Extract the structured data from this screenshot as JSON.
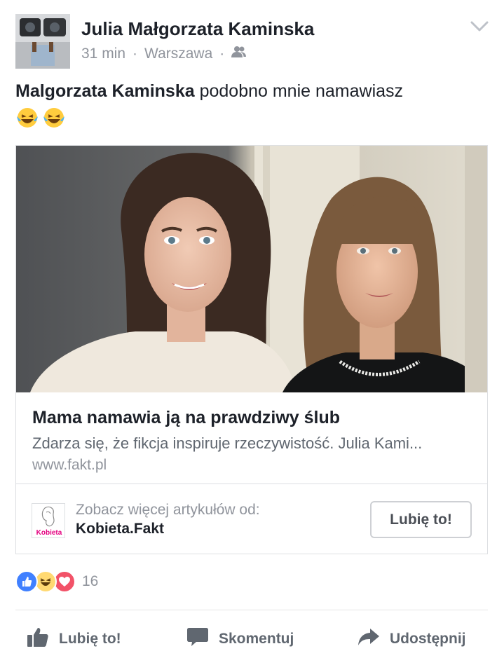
{
  "post": {
    "author": "Julia Małgorzata Kaminska",
    "time": "31 min",
    "separator": "·",
    "location": "Warszawa",
    "audience_icon": "friends-icon",
    "mention": "Malgorzata Kaminska",
    "text": " podobno mnie namawiasz",
    "emojis": [
      "😂",
      "😂"
    ]
  },
  "link_card": {
    "title": "Mama namawia ją na prawdziwy ślub",
    "description": "Zdarza się, że fikcja inspiruje rzeczywistość. Julia Kami...",
    "domain": "www.fakt.pl",
    "page_subtitle": "Zobacz więcej artykułów od:",
    "page_name": "Kobieta.Fakt",
    "page_logo_text": "Kobieta",
    "like_button": "Lubię to!"
  },
  "reactions": {
    "types": [
      "like-icon",
      "haha-icon",
      "love-icon"
    ],
    "count": "16"
  },
  "actions": {
    "like": "Lubię to!",
    "comment": "Skomentuj",
    "share": "Udostępnij"
  },
  "colors": {
    "like_blue": "#4080ff",
    "love_red": "#f25268",
    "haha_yellow": "#ffd972",
    "logo_pink": "#e4007f"
  }
}
